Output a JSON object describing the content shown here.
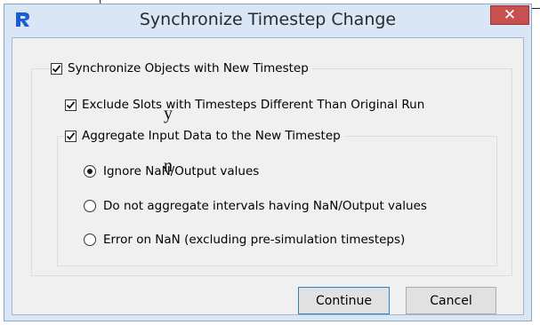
{
  "dialog": {
    "title": "Synchronize Timestep Change",
    "close_label": "✕",
    "colors": {
      "frame": "#d8e6f6",
      "close": "#c75050",
      "app_icon": "#1b5fcf"
    }
  },
  "options": {
    "sync": {
      "label": "Synchronize Objects with New Timestep",
      "checked": true
    },
    "exclude": {
      "label": "Exclude Slots with Timesteps Different Than Original Run",
      "checked": true
    },
    "aggregate": {
      "label": "Aggregate Input Data to the New Timestep",
      "checked": true
    },
    "radios": [
      {
        "label": "Ignore NaN/Output values",
        "selected": true
      },
      {
        "label": "Do not aggregate intervals having NaN/Output values",
        "selected": false
      },
      {
        "label": "Error on NaN  (excluding pre-simulation timesteps)",
        "selected": false
      }
    ]
  },
  "buttons": {
    "continue": "Continue",
    "cancel": "Cancel"
  },
  "background": {
    "char_y": "y",
    "char_n": "n"
  }
}
